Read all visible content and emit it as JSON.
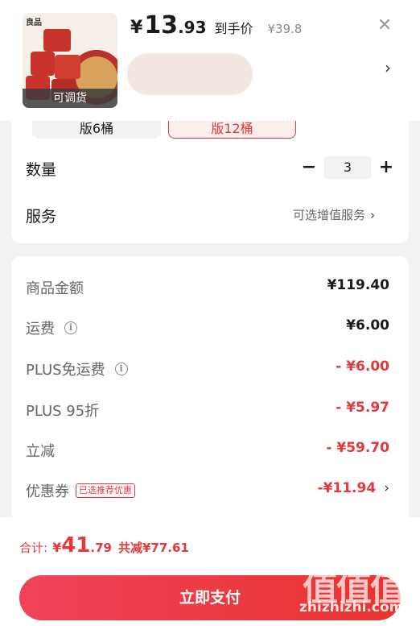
{
  "header": {
    "price_symbol": "¥",
    "price_integer": "13",
    "price_decimal": ".93",
    "price_note": "到手价",
    "original_price": "¥39.8",
    "close_icon": "close-icon",
    "thumb_logo": "良品",
    "thumb_label": "可调货"
  },
  "options": {
    "variants": [
      "版6桶",
      "版12桶"
    ],
    "selected_variant": "版12桶",
    "quantity_label": "数量",
    "quantity_value": "3",
    "minus_label": "−",
    "plus_label": "+",
    "service_label": "服务",
    "service_link": "可选增值服务"
  },
  "summary": {
    "rows": [
      {
        "label": "商品金额",
        "value": "¥119.40"
      },
      {
        "label": "运费",
        "value": "¥6.00"
      },
      {
        "label": "PLUS免运费",
        "value": "- ¥6.00"
      },
      {
        "label": "PLUS 95折",
        "value": "- ¥5.97"
      },
      {
        "label": "立减",
        "value": "- ¥59.70"
      },
      {
        "label": "优惠券",
        "badge": "已选推荐优惠",
        "value": "-¥11.94"
      }
    ]
  },
  "bottom": {
    "total_label": "合计:",
    "total_symbol": "¥",
    "total_integer": "41",
    "total_decimal": ".79",
    "total_saved": "共减¥77.61",
    "pay_button": "立即支付"
  },
  "watermark": {
    "glyphs": "值值值",
    "text": "zhizhizhi.com"
  },
  "colors": {
    "accent": "#e4393c",
    "pay_start": "#f0425a",
    "pay_end": "#e8342f"
  }
}
